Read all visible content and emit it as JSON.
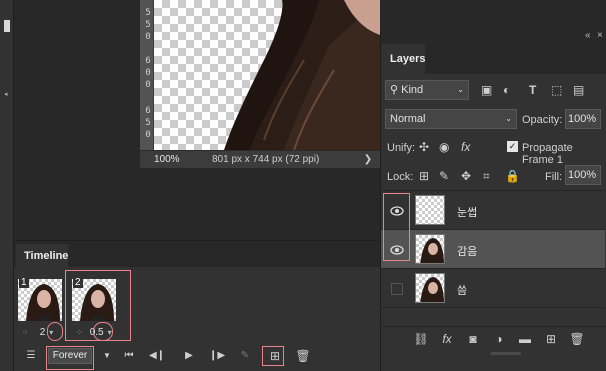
{
  "document": {
    "ruler_numbers": [
      "5",
      "5",
      "0",
      "6",
      "0",
      "0",
      "6",
      "5",
      "0"
    ],
    "zoom": "100%",
    "info": "801 px x 744 px (72 ppi)",
    "info_arrow": "❯"
  },
  "timeline": {
    "tab_label": "Timeline",
    "frames": [
      {
        "number": "1",
        "delay": "2"
      },
      {
        "number": "2",
        "delay": "0.5"
      }
    ],
    "loop_option": "Forever"
  },
  "layers": {
    "collapse_label": "«",
    "close_label": "×",
    "tab_label": "Layers",
    "filter_kind": "Kind",
    "blend_mode": "Normal",
    "opacity_label": "Opacity:",
    "opacity_value": "100%",
    "unify_label": "Unify:",
    "propagate_label": "Propagate Frame 1",
    "lock_label": "Lock:",
    "fill_label": "Fill:",
    "fill_value": "100%",
    "rows": [
      {
        "name": "눈썹",
        "visible": true,
        "selected": false
      },
      {
        "name": "감음",
        "visible": true,
        "selected": true
      },
      {
        "name": "씀",
        "visible": false,
        "selected": false
      }
    ]
  },
  "colors": {
    "panel_bg": "#323232",
    "highlight_box": "#e8848c"
  }
}
